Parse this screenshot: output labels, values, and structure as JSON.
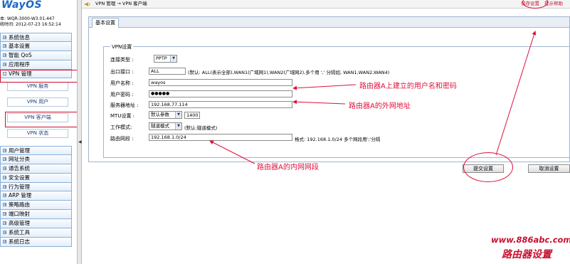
{
  "sidebar": {
    "logo": "WayOS",
    "version": "本: WQR-3000-W3.01.447",
    "system_time": "统时间: 2012-07-23 16:52:14",
    "menu_top": [
      "系统信息",
      "基本设置",
      "智能 QoS",
      "应用程序",
      "VPN 管理"
    ],
    "vpn_sub": [
      "VPN 服务",
      "VPN 用户",
      "VPN 客户端",
      "VPN 状态"
    ],
    "menu_bottom": [
      "用户管理",
      "网址分类",
      "通告系统",
      "安全设置",
      "行为管理",
      "ARP 管理",
      "策略路由",
      "端口映射",
      "高级管理",
      "系统工具",
      "系统日志"
    ]
  },
  "topbar": {
    "breadcrumb": "VPN 管理 → VPN 客户端",
    "save_label": "保存设置",
    "help_label": "提示帮助"
  },
  "tab": {
    "label": "基本设置"
  },
  "form": {
    "legend": "VPN设置",
    "conn_type_label": "连接类型 :",
    "conn_type_value": "PPTP",
    "outlet_label": "出口接口 :",
    "outlet_value": "ALL",
    "outlet_hint": "(默认: ALL(表示全部),WAN1(广域网1),WAN2(广域网2),多个用 ',' 分隔如, WAN1,WAN2,WAN4)",
    "username_label": "用户名称 :",
    "username_value": "wayos",
    "password_label": "用户密码 :",
    "password_value": "●●●●●",
    "server_label": "服务器地址 :",
    "server_value": "192.168.77.114",
    "mtu_label": "MTU设置 :",
    "mtu_select": "默认参数",
    "mtu_value": "1400",
    "mode_label": "工作模式:",
    "mode_value": "隧道模式",
    "mode_hint": "(默认:隧道模式)",
    "route_label": "路由网段 :",
    "route_value": "192.168.1.0/24",
    "route_hint": "格式: 192.168.1.0/24 多个网段用';'分隔"
  },
  "buttons": {
    "submit": "提交设置",
    "cancel": "取消设置"
  },
  "annotations": {
    "userpass": "路由器A上建立的用户名和密码",
    "wan": "路由器A的外网地址",
    "lan": "路由器A的内网网段",
    "color": "#e0103a"
  },
  "watermark": {
    "site": "www.886abc.com",
    "caption": "路由器设置"
  }
}
